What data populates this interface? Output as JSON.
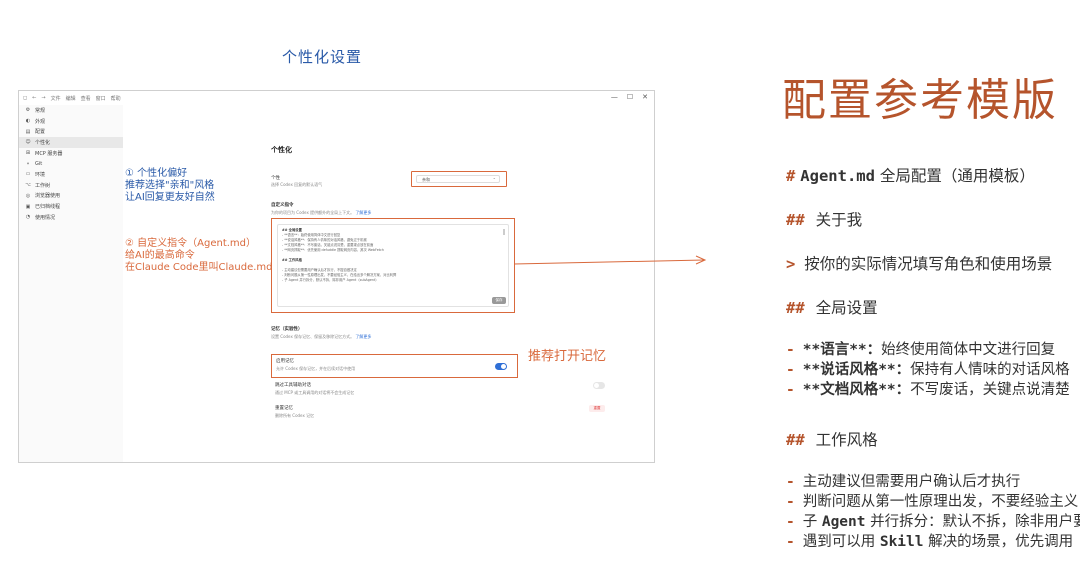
{
  "section_caption": "个性化设置",
  "app": {
    "titlebar": {
      "nav_back": "←",
      "nav_forward": "→",
      "menus": [
        "文件",
        "编辑",
        "查看",
        "窗口",
        "帮助"
      ],
      "minimize": "—",
      "maximize": "☐",
      "close": "✕"
    },
    "sidebar": {
      "items": [
        {
          "icon": "gear-icon",
          "glyph": "⚙",
          "label": "常规"
        },
        {
          "icon": "appearance-icon",
          "glyph": "◐",
          "label": "外观"
        },
        {
          "icon": "config-icon",
          "glyph": "▤",
          "label": "配置"
        },
        {
          "icon": "personalize-icon",
          "glyph": "☺",
          "label": "个性化"
        },
        {
          "icon": "mcp-icon",
          "glyph": "⊞",
          "label": "MCP 服务器"
        },
        {
          "icon": "git-icon",
          "glyph": "⑂",
          "label": "Git"
        },
        {
          "icon": "env-icon",
          "glyph": "▭",
          "label": "环境"
        },
        {
          "icon": "worktree-icon",
          "glyph": "⌥",
          "label": "工作树"
        },
        {
          "icon": "browser-icon",
          "glyph": "◎",
          "label": "浏览器使用"
        },
        {
          "icon": "archive-icon",
          "glyph": "▣",
          "label": "已归档线程"
        },
        {
          "icon": "usage-icon",
          "glyph": "◔",
          "label": "使用情况"
        }
      ],
      "active_index": 3
    },
    "main": {
      "title": "个性化",
      "tone": {
        "label": "个性",
        "desc": "选择 Codex 回复的默认语气",
        "value": "亲和",
        "chevron": "⌄"
      },
      "custom_instructions": {
        "label": "自定义指令",
        "desc": "为你的项目为 Codex 提供额外的全局上下文。",
        "link": "了解更多",
        "lines": [
          {
            "type": "h",
            "text": "## 全局设置"
          },
          {
            "type": "t",
            "text": "- **语言**：始终使用简体中文进行回复"
          },
          {
            "type": "t",
            "text": "- **说话风格**：保持有人情味的对话风格，避免过于机械"
          },
          {
            "type": "t",
            "text": "- **文档风格**：不写废话，关键点说清楚，重要观点放在前面"
          },
          {
            "type": "t",
            "text": "- **网页抓取**：优先使用 defuddle 提取网页内容，其次 WebFetch"
          },
          {
            "type": "gap",
            "text": ""
          },
          {
            "type": "h",
            "text": "## 工作风格"
          },
          {
            "type": "gap",
            "text": ""
          },
          {
            "type": "t",
            "text": "- 主动建议但需要用户确认后才执行，不擅自做决定"
          },
          {
            "type": "t",
            "text": "- 判断问题从第一性原理出发，不要经验主义，在给出多个解决方案，对比利弊"
          },
          {
            "type": "t",
            "text": "- 子 Agent 并行拆分，默认不拆，除非用户 Agent（subAgent）"
          }
        ],
        "save": "保存"
      },
      "memory": {
        "label": "记忆（实验性）",
        "desc": "设置 Codex 保存记忆、保留及移除记忆方式。",
        "link": "了解更多",
        "enable_label": "启用记忆",
        "enable_desc": "允许 Codex 保存记忆，并在后续对话中使用",
        "enable_on": true,
        "skip_label": "跳过工具辅助对话",
        "skip_desc": "通过 MCP 或工具调用的对话将不会生成记忆",
        "skip_on": false,
        "reset_label": "重置记忆",
        "reset_desc": "删除所有 Codex 记忆",
        "reset_button": "重置"
      }
    }
  },
  "annotations": {
    "a1": [
      "① 个性化偏好",
      "推荐选择\"亲和\"风格",
      "让AI回复更友好自然"
    ],
    "a2": [
      "② 自定义指令（Agent.md）",
      "给AI的最高命令",
      "在Claude Code里叫Claude.md"
    ],
    "a3": "推荐打开记忆"
  },
  "template": {
    "title": "配置参考模版",
    "h1_mark": "#",
    "h1_code": "Agent.md",
    "h1_rest": "全局配置（通用模板）",
    "about_mark": "##",
    "about_label": "关于我",
    "quote_mark": ">",
    "quote_text": "按你的实际情况填写角色和使用场景",
    "global_mark": "##",
    "global_label": "全局设置",
    "global_items": [
      {
        "key": "**语言**：",
        "text": "始终使用简体中文进行回复"
      },
      {
        "key": "**说话风格**：",
        "text": "保持有人情味的对话风格"
      },
      {
        "key": "**文档风格**：",
        "text": "不写废话，关键点说清楚"
      }
    ],
    "work_mark": "##",
    "work_label": "工作风格",
    "work_items": [
      {
        "pre": "主动建议但需要用户确认后才执行",
        "kw": "",
        "post": ""
      },
      {
        "pre": "判断问题从第一性原理出发，不要经验主义",
        "kw": "",
        "post": ""
      },
      {
        "pre": "子 ",
        "kw": "Agent",
        "post": " 并行拆分：默认不拆，除非用户要求"
      },
      {
        "pre": "遇到可以用 ",
        "kw": "Skill",
        "post": " 解决的场景，优先调用"
      }
    ],
    "list_marker": "-"
  },
  "colors": {
    "accent": "#d9693c",
    "title_brown": "#b5542c",
    "blue": "#2a5aa8",
    "toggle_blue": "#2f6fd6"
  }
}
